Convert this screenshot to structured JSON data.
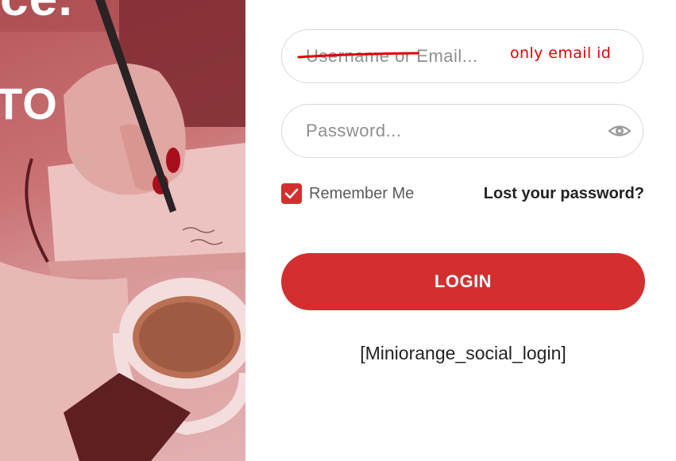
{
  "hero": {
    "heading_fragment_top": "ce.",
    "heading_fragment_mid": "TO"
  },
  "form": {
    "username": {
      "placeholder": "Username or Email...",
      "value": "",
      "annotation": "only email id"
    },
    "password": {
      "placeholder": "Password...",
      "value": "",
      "toggle_icon": "eye-icon"
    },
    "remember": {
      "label": "Remember Me",
      "checked": true
    },
    "lost_password_label": "Lost your password?",
    "login_label": "LOGIN",
    "social_shortcode": "[Miniorange_social_login]"
  },
  "colors": {
    "accent": "#d32f2f",
    "annotation": "#e00000",
    "hero_tint": "#c97173"
  }
}
